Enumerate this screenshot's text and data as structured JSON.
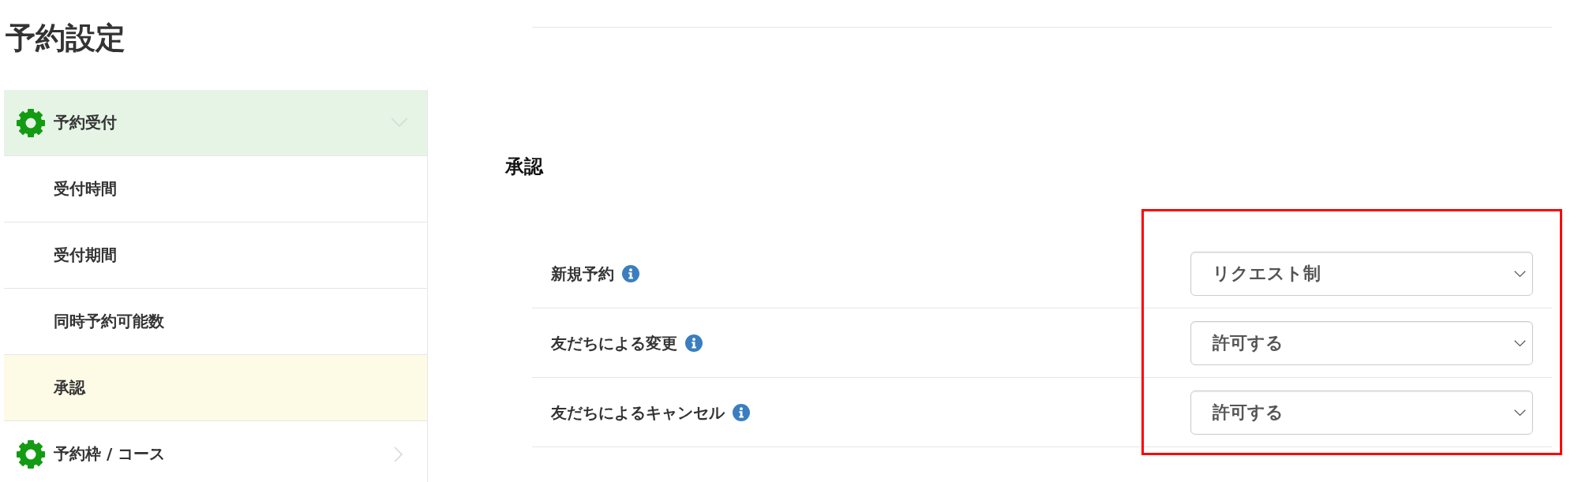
{
  "page": {
    "title": "予約設定"
  },
  "sidebar": {
    "groups": [
      {
        "label": "予約受付",
        "expanded": true,
        "children": [
          {
            "label": "受付時間",
            "selected": false
          },
          {
            "label": "受付期間",
            "selected": false
          },
          {
            "label": "同時予約可能数",
            "selected": false
          },
          {
            "label": "承認",
            "selected": true
          }
        ]
      },
      {
        "label": "予約枠 / コース",
        "expanded": false
      }
    ]
  },
  "section": {
    "heading": "承認",
    "controls_highlighted": true,
    "rows": [
      {
        "label": "新規予約",
        "value": "リクエスト制"
      },
      {
        "label": "友だちによる変更",
        "value": "許可する"
      },
      {
        "label": "友だちによるキャンセル",
        "value": "許可する"
      }
    ]
  }
}
